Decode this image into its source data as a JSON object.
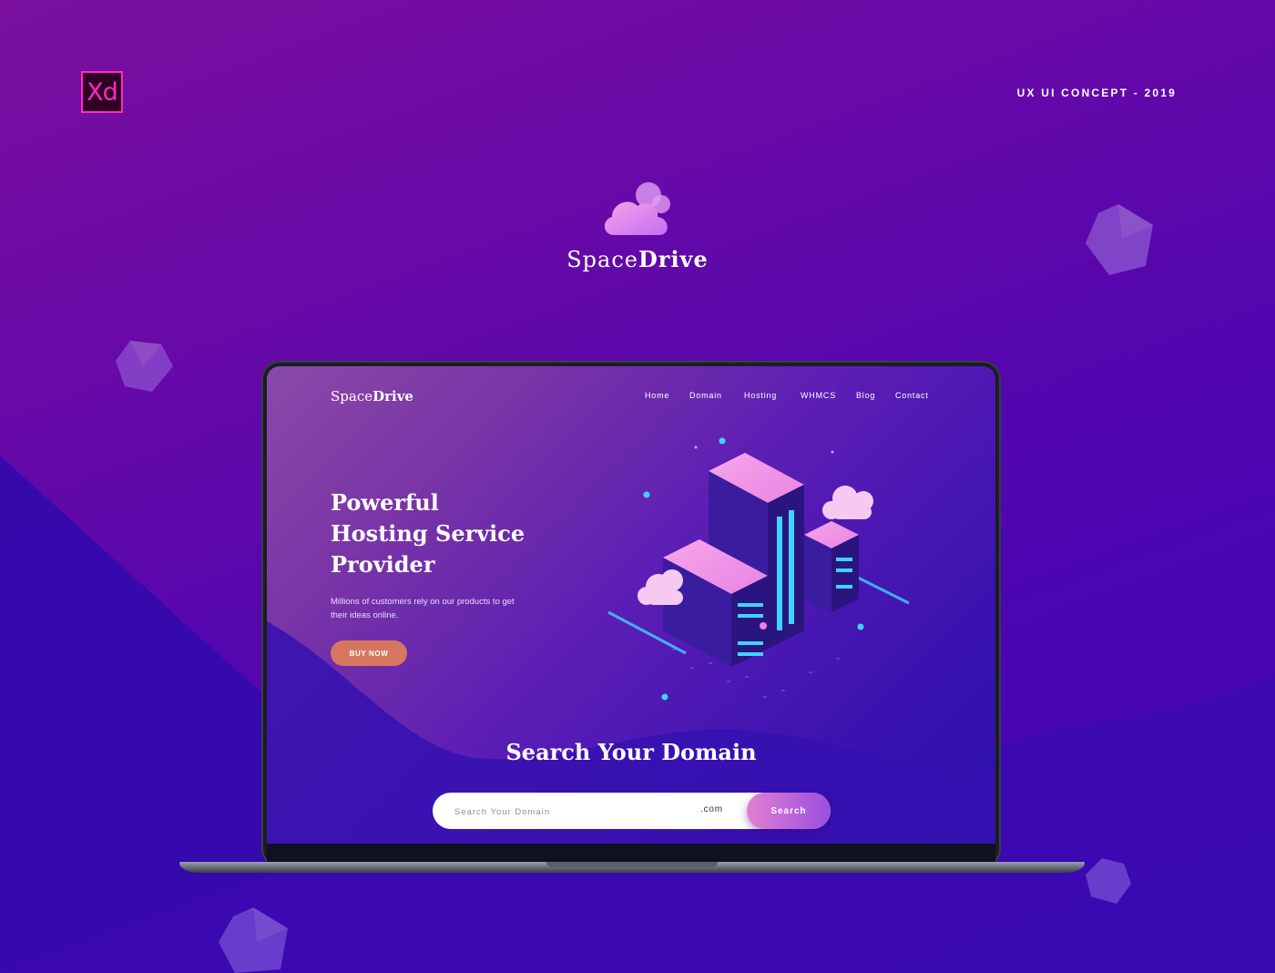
{
  "badge": {
    "app": "Xd",
    "concept": "UX UI CONCEPT - 2019"
  },
  "brand": {
    "part1": "Space",
    "part2": "Drive"
  },
  "site": {
    "logo_part1": "Space",
    "logo_part2": "Drive",
    "nav": [
      "Home",
      "Domain",
      "Hosting",
      "WHMCS",
      "Blog",
      "Contact"
    ],
    "hero": {
      "title_lines": [
        "Powerful",
        "Hosting Service",
        "Provider"
      ],
      "subtitle": "Millions of customers rely on our products to get their ideas online.",
      "cta": "BUY NOW"
    },
    "search": {
      "heading": "Search Your Domain",
      "placeholder": "Search Your Domain",
      "tld": ".com",
      "button": "Search"
    }
  },
  "colors": {
    "accent_pink": "#e07fd0",
    "cta_orange": "#d7765f",
    "xd_pink": "#ff2bc2",
    "cyan": "#3fd4ff"
  }
}
